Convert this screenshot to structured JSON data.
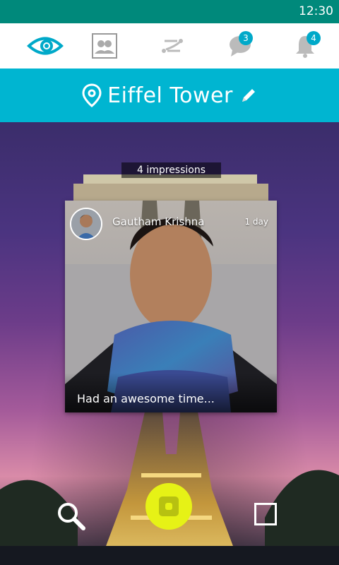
{
  "status_bar": {
    "time": "12:30"
  },
  "tabs": [
    {
      "icon": "eye-logo-icon"
    },
    {
      "icon": "group-contacts-icon"
    },
    {
      "icon": "route-icon"
    },
    {
      "icon": "chat-icon",
      "badge": "3"
    },
    {
      "icon": "bell-icon",
      "badge": "4"
    }
  ],
  "location": {
    "name": "Eiffel Tower",
    "pin_icon": "location-pin-icon",
    "edit_icon": "pencil-icon"
  },
  "post": {
    "impressions": "4 impressions",
    "author": "Gautham Krishna",
    "age": "1 day",
    "caption": "Had an awesome time..."
  },
  "bottom_controls": {
    "search_icon": "search-icon",
    "record_icon": "record-button-icon",
    "square_icon": "square-icon"
  },
  "colors": {
    "status_bar": "#00897b",
    "accent": "#00b5d1",
    "record": "#e6f216"
  }
}
